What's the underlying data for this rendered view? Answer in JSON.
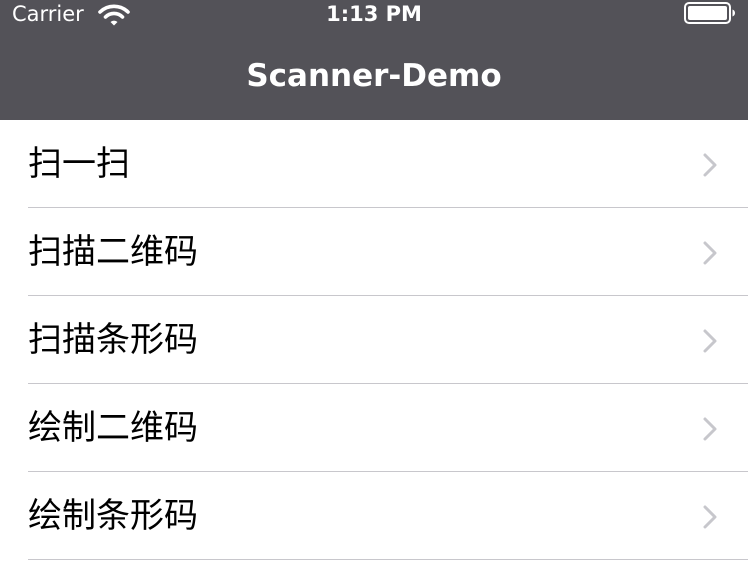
{
  "status_bar": {
    "carrier": "Carrier",
    "time": "1:13 PM"
  },
  "nav_bar": {
    "title": "Scanner-Demo",
    "background_color": "#535258"
  },
  "menu": {
    "items": [
      {
        "label": "扫一扫"
      },
      {
        "label": "扫描二维码"
      },
      {
        "label": "扫描条形码"
      },
      {
        "label": "绘制二维码"
      },
      {
        "label": "绘制条形码"
      }
    ]
  },
  "icons": {
    "wifi": "wifi-icon",
    "battery": "battery-icon",
    "disclosure": "chevron-right-icon"
  }
}
